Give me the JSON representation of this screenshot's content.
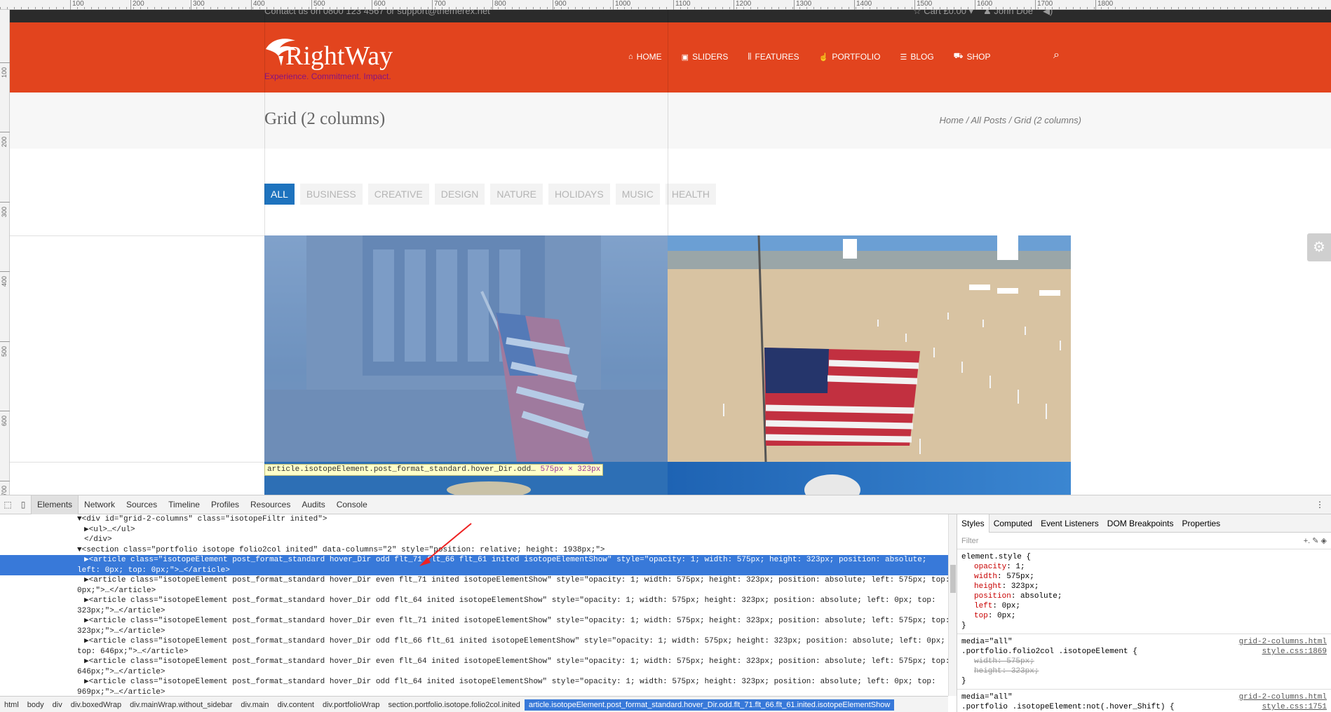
{
  "ruler": {
    "top_ticks": [
      "100",
      "200",
      "300",
      "400",
      "500",
      "600",
      "700",
      "800",
      "900",
      "1000",
      "1100",
      "1200",
      "1300",
      "1400",
      "1500",
      "1600",
      "1700",
      "1800"
    ],
    "left_ticks": [
      "100",
      "200",
      "300",
      "400",
      "500",
      "600",
      "700"
    ]
  },
  "topbar": {
    "contact": "Contact us on 0800 123 4567 or support@themerex.net",
    "cart": "Cart £0.00",
    "user": "John Doe"
  },
  "logo": {
    "name": "RightWay",
    "tagline": "Experience. Commitment. Impact."
  },
  "nav": [
    {
      "label": "HOME",
      "icon": "home-icon"
    },
    {
      "label": "SLIDERS",
      "icon": "image-icon"
    },
    {
      "label": "FEATURES",
      "icon": "sliders-icon"
    },
    {
      "label": "PORTFOLIO",
      "icon": "thumb-up-icon"
    },
    {
      "label": "BLOG",
      "icon": "list-icon"
    },
    {
      "label": "SHOP",
      "icon": "cart-icon"
    }
  ],
  "title": {
    "heading": "Grid (2 columns)",
    "breadcrumb": "Home / All Posts / Grid (2 columns)"
  },
  "filters": [
    "ALL",
    "BUSINESS",
    "CREATIVE",
    "DESIGN",
    "NATURE",
    "HOLIDAYS",
    "MUSIC",
    "HEALTH"
  ],
  "tooltip": {
    "selector": "article.isotopeElement.post_format_standard.hover_Dir.odd…",
    "size": "575px × 323px"
  },
  "devtools": {
    "tabs": [
      "Elements",
      "Network",
      "Sources",
      "Timeline",
      "Profiles",
      "Resources",
      "Audits",
      "Console"
    ],
    "html_lines": [
      "▼<div id=\"grid-2-columns\" class=\"isotopeFiltr inited\">",
      "  ▶<ul>…</ul>",
      "  </div>",
      "▼<section class=\"portfolio isotope folio2col inited\" data-columns=\"2\" style=\"position: relative; height: 1938px;\">",
      "  ▶<article class=\"isotopeElement post_format_standard hover_Dir odd flt_71 flt_66 flt_61 inited isotopeElementShow\" style=\"opacity: 1; width: 575px; height: 323px; position: absolute;",
      "  left: 0px; top: 0px;\">…</article>",
      "  ▶<article class=\"isotopeElement post_format_standard hover_Dir even flt_71 inited isotopeElementShow\" style=\"opacity: 1; width: 575px; height: 323px; position: absolute; left: 575px; top:",
      "  0px;\">…</article>",
      "  ▶<article class=\"isotopeElement post_format_standard hover_Dir odd flt_64 inited isotopeElementShow\" style=\"opacity: 1; width: 575px; height: 323px; position: absolute; left: 0px; top:",
      "  323px;\">…</article>",
      "  ▶<article class=\"isotopeElement post_format_standard hover_Dir even flt_71 inited isotopeElementShow\" style=\"opacity: 1; width: 575px; height: 323px; position: absolute; left: 575px; top:",
      "  323px;\">…</article>",
      "  ▶<article class=\"isotopeElement post_format_standard hover_Dir odd flt_66 flt_61 inited isotopeElementShow\" style=\"opacity: 1; width: 575px; height: 323px; position: absolute; left: 0px;",
      "  top: 646px;\">…</article>",
      "  ▶<article class=\"isotopeElement post_format_standard hover_Dir even flt_64 inited isotopeElementShow\" style=\"opacity: 1; width: 575px; height: 323px; position: absolute; left: 575px; top:",
      "  646px;\">…</article>",
      "  ▶<article class=\"isotopeElement post_format_standard hover_Dir odd flt_64 inited isotopeElementShow\" style=\"opacity: 1; width: 575px; height: 323px; position: absolute; left: 0px; top:",
      "  969px;\">…</article>"
    ],
    "styles_tabs": [
      "Styles",
      "Computed",
      "Event Listeners",
      "DOM Breakpoints",
      "Properties"
    ],
    "filter_placeholder": "Filter",
    "element_style_selector": "element.style {",
    "element_style": [
      {
        "k": "opacity",
        "v": "1;"
      },
      {
        "k": "width",
        "v": "575px;"
      },
      {
        "k": "height",
        "v": "323px;"
      },
      {
        "k": "position",
        "v": "absolute;"
      },
      {
        "k": "left",
        "v": "0px;"
      },
      {
        "k": "top",
        "v": "0px;"
      }
    ],
    "rule1": {
      "media": "media=\"all\"",
      "source1": "grid-2-columns.html",
      "source2": "style.css:1869",
      "selector": ".portfolio.folio2col .isotopeElement {",
      "props": [
        {
          "k": "width",
          "v": "575px;"
        },
        {
          "k": "height",
          "v": "323px;"
        }
      ]
    },
    "rule2": {
      "media": "media=\"all\"",
      "source1": "grid-2-columns.html",
      "source2": "style.css:1751",
      "selector": ".portfolio .isotopeElement:not(.hover_Shift) {"
    },
    "breadcrumb": [
      "html",
      "body",
      "div",
      "div.boxedWrap",
      "div.mainWrap.without_sidebar",
      "div.main",
      "div.content",
      "div.portfolioWrap",
      "section.portfolio.isotope.folio2col.inited",
      "article.isotopeElement.post_format_standard.hover_Dir.odd.flt_71.flt_66.flt_61.inited.isotopeElementShow"
    ]
  }
}
